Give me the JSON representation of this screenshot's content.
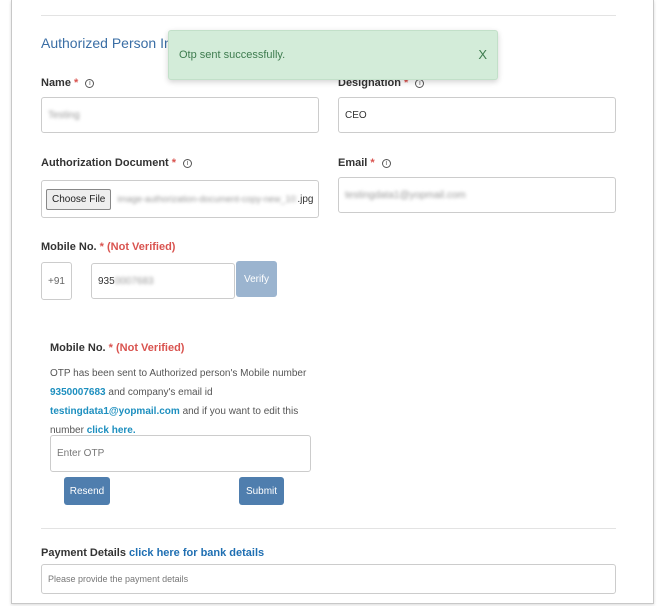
{
  "section": {
    "title": "Authorized Person Informa"
  },
  "toast": {
    "message": "Otp sent successfully.",
    "close": "X"
  },
  "fields": {
    "name": {
      "label": "Name",
      "required": "*",
      "info": "i",
      "value": "Testing"
    },
    "designation": {
      "label": "Designation",
      "required": "*",
      "info": "i",
      "value": "CEO"
    },
    "auth_doc": {
      "label": "Authorization Document",
      "required": "*",
      "info": "i",
      "button": "Choose File",
      "filename": "image-authorization-document-copy-new_101111500",
      "ext": ".jpg"
    },
    "email": {
      "label": "Email",
      "required": "*",
      "info": "i",
      "value": "testingdata1@yopmail.com"
    },
    "mobile": {
      "label": "Mobile No.",
      "required": "*",
      "status": "(Not Verified)",
      "prefix": "+91",
      "value_visible": "935",
      "value_hidden": "0007683",
      "verify": "Verify"
    }
  },
  "otp": {
    "label": "Mobile No.",
    "required": "*",
    "status": "(Not Verified)",
    "text_1": "OTP has been sent to Authorized person's Mobile number",
    "phone": "9350007683",
    "text_2": "and company's email id",
    "email": "testingdata1@yopmail.com",
    "text_3": "and if you want to edit this number",
    "link": "click here.",
    "placeholder": "Enter OTP",
    "resend": "Resend",
    "submit": "Submit"
  },
  "payment": {
    "label": "Payment Details",
    "link": "click here for bank details",
    "placeholder": "Please provide the payment details"
  }
}
